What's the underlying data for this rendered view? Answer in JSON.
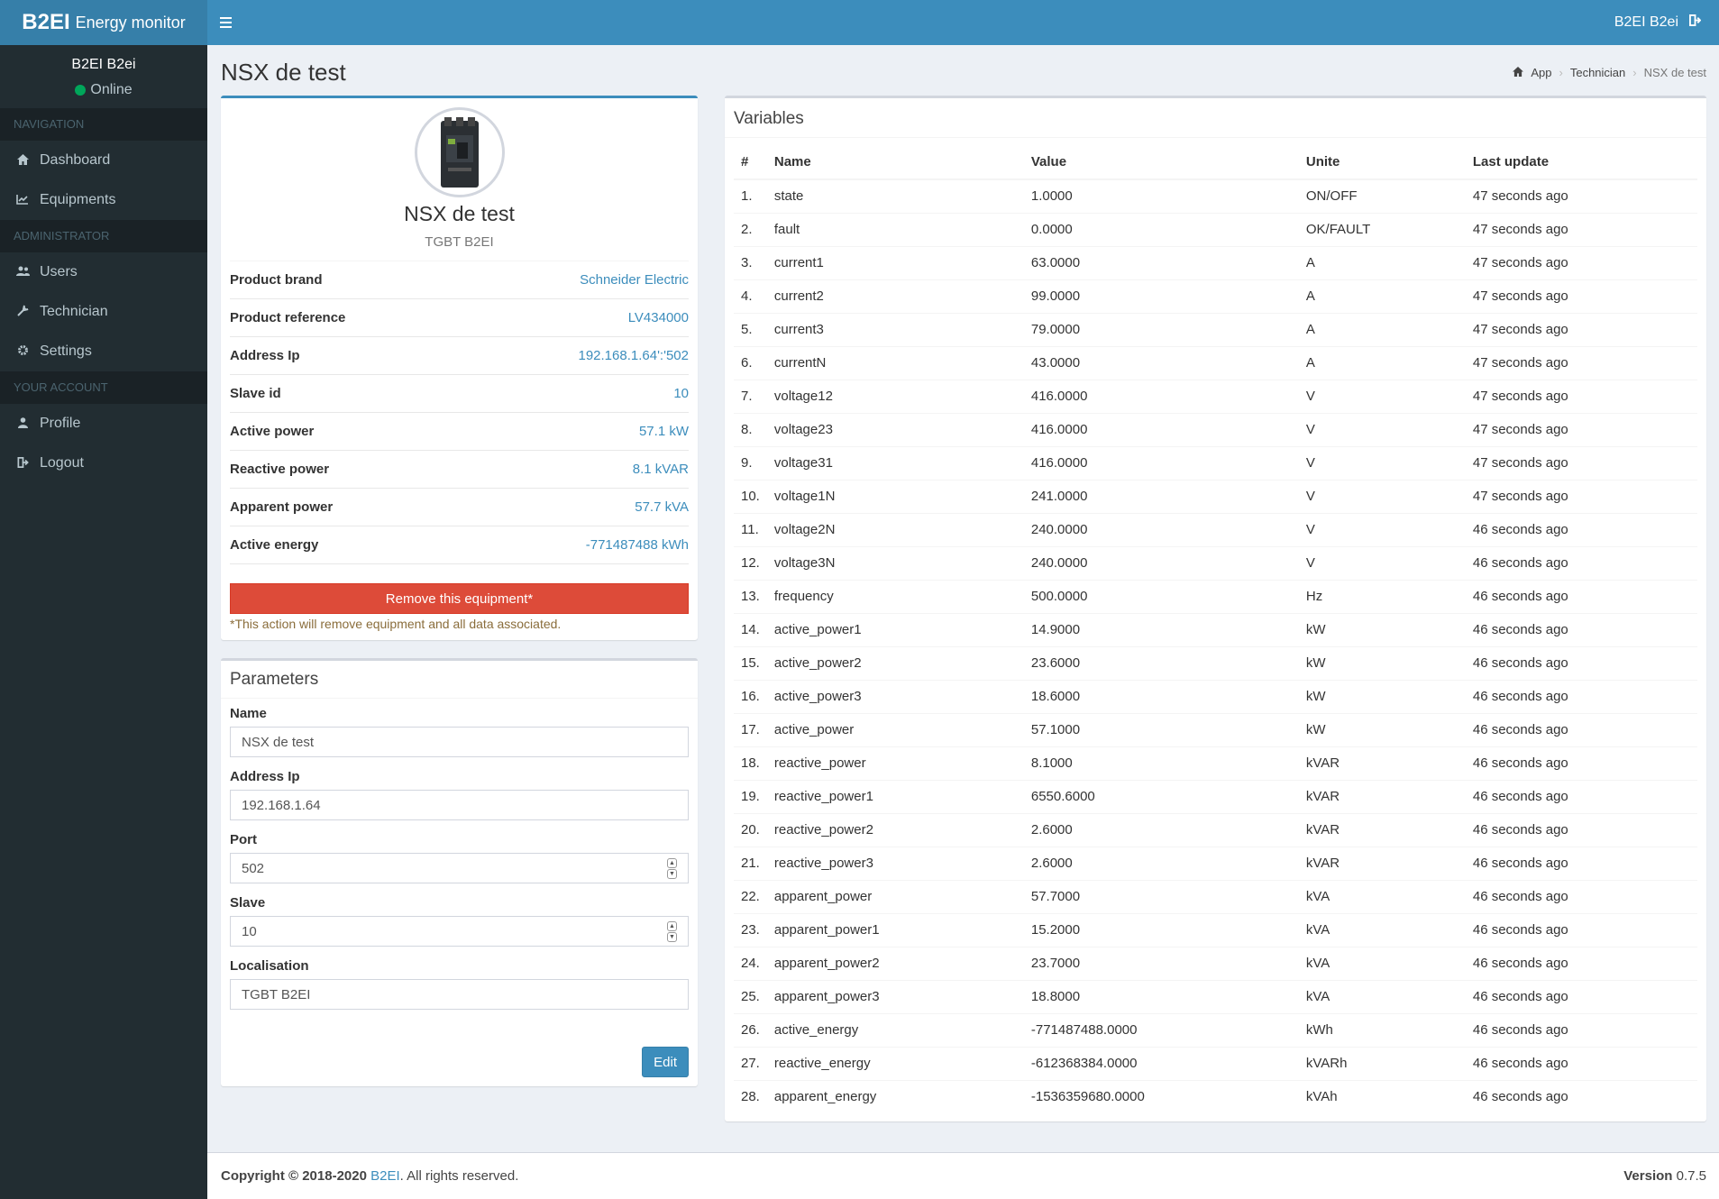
{
  "header": {
    "logo_bold": "B2EI",
    "logo_light": "Energy monitor",
    "user_name": "B2EI B2ei"
  },
  "sidebar": {
    "user_name": "B2EI B2ei",
    "status": "Online",
    "sections": [
      {
        "header": "NAVIGATION",
        "items": [
          {
            "icon": "home-icon",
            "label": "Dashboard"
          },
          {
            "icon": "line-chart-icon",
            "label": "Equipments"
          }
        ]
      },
      {
        "header": "ADMINISTRATOR",
        "items": [
          {
            "icon": "users-icon",
            "label": "Users"
          },
          {
            "icon": "wrench-icon",
            "label": "Technician"
          },
          {
            "icon": "gear-icon",
            "label": "Settings"
          }
        ]
      },
      {
        "header": "YOUR ACCOUNT",
        "items": [
          {
            "icon": "user-icon",
            "label": "Profile"
          },
          {
            "icon": "logout-icon",
            "label": "Logout"
          }
        ]
      }
    ]
  },
  "page": {
    "title": "NSX de test",
    "breadcrumb": [
      "App",
      "Technician",
      "NSX de test"
    ]
  },
  "profile": {
    "name": "NSX de test",
    "location": "TGBT B2EI",
    "rows": [
      {
        "label": "Product brand",
        "value": "Schneider Electric"
      },
      {
        "label": "Product reference",
        "value": "LV434000"
      },
      {
        "label": "Address Ip",
        "value": "192.168.1.64':'502"
      },
      {
        "label": "Slave id",
        "value": "10"
      },
      {
        "label": "Active power",
        "value": "57.1 kW"
      },
      {
        "label": "Reactive power",
        "value": "8.1 kVAR"
      },
      {
        "label": "Apparent power",
        "value": "57.7 kVA"
      },
      {
        "label": "Active energy",
        "value": "-771487488 kWh"
      }
    ],
    "remove_label": "Remove this equipment*",
    "warning": "*This action will remove equipment and all data associated."
  },
  "parameters": {
    "title": "Parameters",
    "fields": [
      {
        "label": "Name",
        "value": "NSX de test",
        "spinner": false
      },
      {
        "label": "Address Ip",
        "value": "192.168.1.64",
        "spinner": false
      },
      {
        "label": "Port",
        "value": "502",
        "spinner": true
      },
      {
        "label": "Slave",
        "value": "10",
        "spinner": true
      },
      {
        "label": "Localisation",
        "value": "TGBT B2EI",
        "spinner": false
      }
    ],
    "edit_label": "Edit"
  },
  "variables": {
    "title": "Variables",
    "columns": [
      "#",
      "Name",
      "Value",
      "Unite",
      "Last update"
    ],
    "rows": [
      [
        "1.",
        "state",
        "1.0000",
        "ON/OFF",
        "47 seconds ago"
      ],
      [
        "2.",
        "fault",
        "0.0000",
        "OK/FAULT",
        "47 seconds ago"
      ],
      [
        "3.",
        "current1",
        "63.0000",
        "A",
        "47 seconds ago"
      ],
      [
        "4.",
        "current2",
        "99.0000",
        "A",
        "47 seconds ago"
      ],
      [
        "5.",
        "current3",
        "79.0000",
        "A",
        "47 seconds ago"
      ],
      [
        "6.",
        "currentN",
        "43.0000",
        "A",
        "47 seconds ago"
      ],
      [
        "7.",
        "voltage12",
        "416.0000",
        "V",
        "47 seconds ago"
      ],
      [
        "8.",
        "voltage23",
        "416.0000",
        "V",
        "47 seconds ago"
      ],
      [
        "9.",
        "voltage31",
        "416.0000",
        "V",
        "47 seconds ago"
      ],
      [
        "10.",
        "voltage1N",
        "241.0000",
        "V",
        "47 seconds ago"
      ],
      [
        "11.",
        "voltage2N",
        "240.0000",
        "V",
        "46 seconds ago"
      ],
      [
        "12.",
        "voltage3N",
        "240.0000",
        "V",
        "46 seconds ago"
      ],
      [
        "13.",
        "frequency",
        "500.0000",
        "Hz",
        "46 seconds ago"
      ],
      [
        "14.",
        "active_power1",
        "14.9000",
        "kW",
        "46 seconds ago"
      ],
      [
        "15.",
        "active_power2",
        "23.6000",
        "kW",
        "46 seconds ago"
      ],
      [
        "16.",
        "active_power3",
        "18.6000",
        "kW",
        "46 seconds ago"
      ],
      [
        "17.",
        "active_power",
        "57.1000",
        "kW",
        "46 seconds ago"
      ],
      [
        "18.",
        "reactive_power",
        "8.1000",
        "kVAR",
        "46 seconds ago"
      ],
      [
        "19.",
        "reactive_power1",
        "6550.6000",
        "kVAR",
        "46 seconds ago"
      ],
      [
        "20.",
        "reactive_power2",
        "2.6000",
        "kVAR",
        "46 seconds ago"
      ],
      [
        "21.",
        "reactive_power3",
        "2.6000",
        "kVAR",
        "46 seconds ago"
      ],
      [
        "22.",
        "apparent_power",
        "57.7000",
        "kVA",
        "46 seconds ago"
      ],
      [
        "23.",
        "apparent_power1",
        "15.2000",
        "kVA",
        "46 seconds ago"
      ],
      [
        "24.",
        "apparent_power2",
        "23.7000",
        "kVA",
        "46 seconds ago"
      ],
      [
        "25.",
        "apparent_power3",
        "18.8000",
        "kVA",
        "46 seconds ago"
      ],
      [
        "26.",
        "active_energy",
        "-771487488.0000",
        "kWh",
        "46 seconds ago"
      ],
      [
        "27.",
        "reactive_energy",
        "-612368384.0000",
        "kVARh",
        "46 seconds ago"
      ],
      [
        "28.",
        "apparent_energy",
        "-1536359680.0000",
        "kVAh",
        "46 seconds ago"
      ]
    ]
  },
  "footer": {
    "copyright_prefix": "Copyright © 2018-2020",
    "company": "B2EI",
    "suffix": ". All rights reserved.",
    "version_label": "Version",
    "version": "0.7.5"
  },
  "colors": {
    "header": "#3c8dbc",
    "logo": "#367fa9",
    "sidebar": "#222d32",
    "danger": "#dd4b39",
    "online": "#00a65a"
  }
}
